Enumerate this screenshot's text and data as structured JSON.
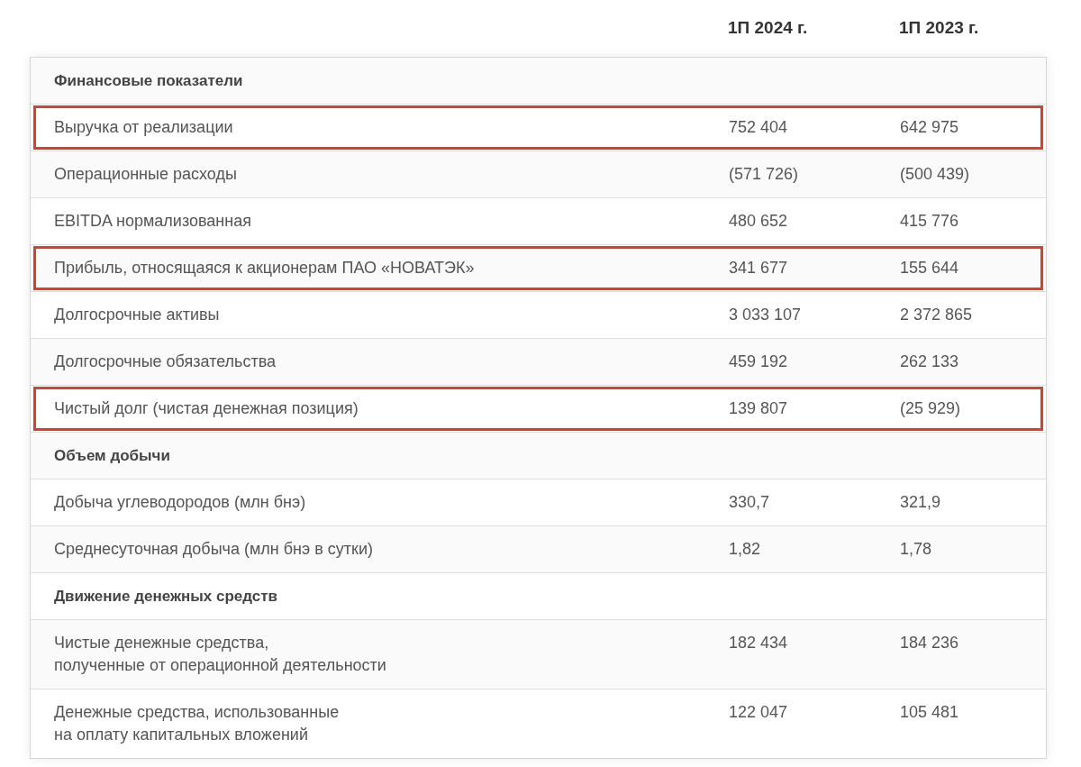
{
  "columns": [
    "1П 2024 г.",
    "1П 2023 г."
  ],
  "rows": [
    {
      "kind": "section",
      "label": "Финансовые показатели",
      "highlighted": false
    },
    {
      "kind": "data",
      "label": "Выручка от реализации",
      "values": [
        "752 404",
        "642 975"
      ],
      "highlighted": true
    },
    {
      "kind": "data",
      "label": "Операционные расходы",
      "values": [
        "(571 726)",
        "(500 439)"
      ],
      "highlighted": false
    },
    {
      "kind": "data",
      "label": "EBITDA нормализованная",
      "values": [
        "480 652",
        "415 776"
      ],
      "highlighted": false
    },
    {
      "kind": "data",
      "label": "Прибыль, относящаяся к акционерам ПАО «НОВАТЭК»",
      "values": [
        "341 677",
        "155 644"
      ],
      "highlighted": true
    },
    {
      "kind": "data",
      "label": "Долгосрочные активы",
      "values": [
        "3 033 107",
        "2 372 865"
      ],
      "highlighted": false
    },
    {
      "kind": "data",
      "label": "Долгосрочные обязательства",
      "values": [
        "459 192",
        "262 133"
      ],
      "highlighted": false
    },
    {
      "kind": "data",
      "label": "Чистый долг (чистая денежная позиция)",
      "values": [
        "139 807",
        "(25 929)"
      ],
      "highlighted": true
    },
    {
      "kind": "section",
      "label": "Объем добычи",
      "highlighted": false
    },
    {
      "kind": "data",
      "label": "Добыча углеводородов (млн бнэ)",
      "values": [
        "330,7",
        "321,9"
      ],
      "highlighted": false
    },
    {
      "kind": "data",
      "label": "Среднесуточная добыча (млн бнэ в сутки)",
      "values": [
        "1,82",
        "1,78"
      ],
      "highlighted": false
    },
    {
      "kind": "section",
      "label": "Движение денежных средств",
      "highlighted": false
    },
    {
      "kind": "data",
      "label": "Чистые денежные средства,\nполученные от операционной деятельности",
      "values": [
        "182 434",
        "184 236"
      ],
      "highlighted": false
    },
    {
      "kind": "data",
      "label": "Денежные средства, использованные\nна оплату капитальных вложений",
      "values": [
        "122 047",
        "105 481"
      ],
      "highlighted": false
    }
  ]
}
